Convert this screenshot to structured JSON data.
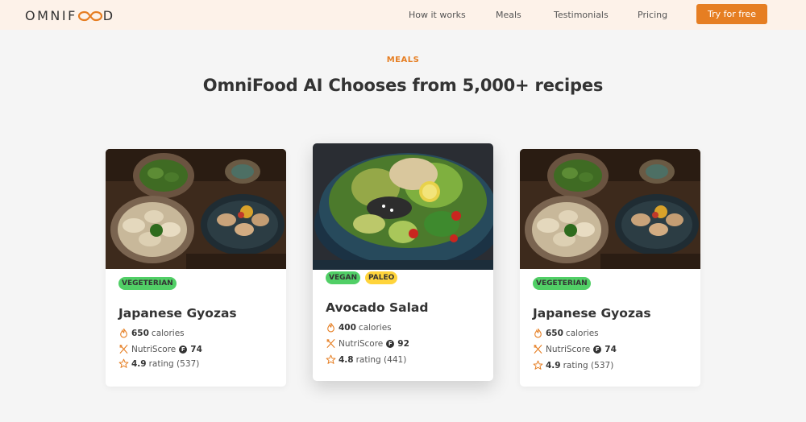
{
  "header": {
    "logo_left": "OMNIF",
    "logo_right": "D",
    "nav": [
      "How it works",
      "Meals",
      "Testimonials",
      "Pricing"
    ],
    "cta": "Try for free"
  },
  "section": {
    "subheading": "MEALS",
    "heading": "OmniFood AI Chooses from 5,000+ recipes"
  },
  "cards": [
    {
      "tags": [
        "VEGETERIAN"
      ],
      "title": "Japanese Gyozas",
      "calories_value": "650",
      "calories_label": "calories",
      "nutri_label": "NutriScore",
      "nutri_badge": "F",
      "nutri_value": "74",
      "rating_value": "4.9",
      "rating_label": "rating (537)"
    },
    {
      "tags": [
        "VEGAN",
        "PALEO"
      ],
      "title": "Avocado Salad",
      "calories_value": "400",
      "calories_label": "calories",
      "nutri_label": "NutriScore",
      "nutri_badge": "F",
      "nutri_value": "92",
      "rating_value": "4.8",
      "rating_label": "rating (441)"
    },
    {
      "tags": [
        "VEGETERIAN"
      ],
      "title": "Japanese Gyozas",
      "calories_value": "650",
      "calories_label": "calories",
      "nutri_label": "NutriScore",
      "nutri_badge": "F",
      "nutri_value": "74",
      "rating_value": "4.9",
      "rating_label": "rating (537)"
    }
  ],
  "colors": {
    "accent": "#e67e22",
    "nav_bg": "#fdf2e9",
    "tag_green": "#51cf66",
    "tag_yellow": "#ffd43b"
  }
}
